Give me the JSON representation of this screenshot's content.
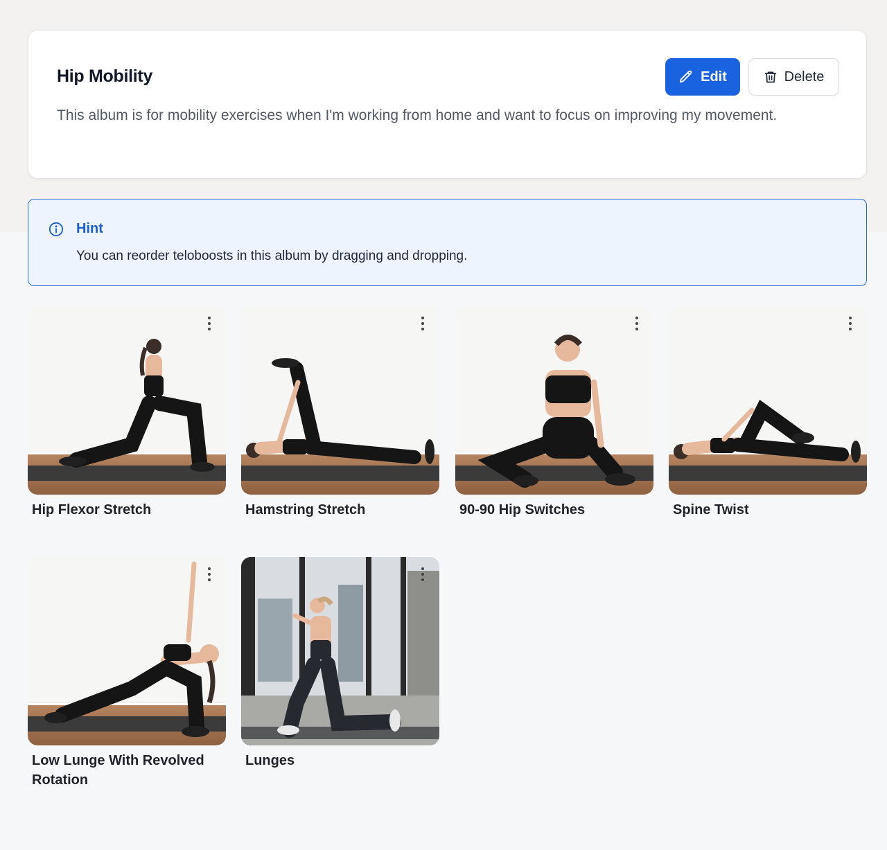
{
  "album": {
    "title": "Hip Mobility",
    "description": "This album is for mobility exercises when I'm working from home and want to focus on improving my movement.",
    "edit_label": "Edit",
    "delete_label": "Delete"
  },
  "hint": {
    "title": "Hint",
    "text": "You can reorder teloboosts in this album by dragging and dropping."
  },
  "teloboosts": [
    {
      "title": "Hip Flexor Stretch"
    },
    {
      "title": "Hamstring Stretch"
    },
    {
      "title": "90-90 Hip Switches"
    },
    {
      "title": "Spine Twist"
    },
    {
      "title": "Low Lunge With Revolved Rotation"
    },
    {
      "title": "Lunges"
    }
  ],
  "colors": {
    "primary": "#1a63e0",
    "hint_bg": "#edf4fe",
    "hint_border": "#2b6fd6"
  }
}
